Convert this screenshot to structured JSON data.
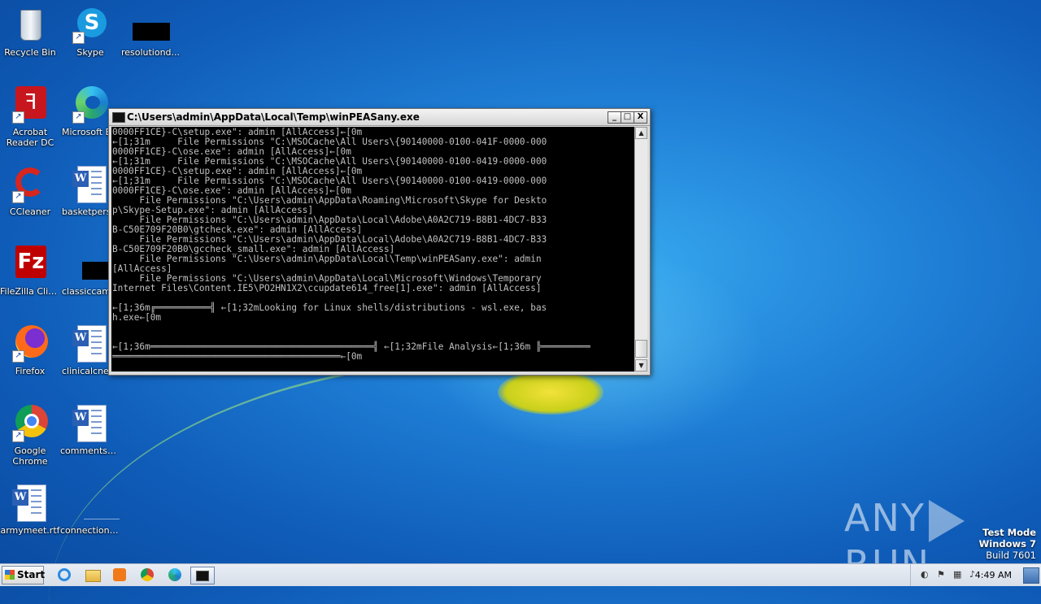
{
  "desktop": {
    "icons": [
      {
        "label": "Recycle Bin"
      },
      {
        "label": "Skype"
      },
      {
        "label": "resolutiond..."
      },
      {
        "label": "Acrobat Reader DC"
      },
      {
        "label": "Microsoft Ed"
      },
      {
        "label": "CCleaner"
      },
      {
        "label": "basketperso"
      },
      {
        "label": "FileZilla Client"
      },
      {
        "label": "classiccame"
      },
      {
        "label": "Firefox"
      },
      {
        "label": "clinicalcnet"
      },
      {
        "label": "Google Chrome"
      },
      {
        "label": "commentsst..."
      },
      {
        "label": "armymeet.rtf"
      },
      {
        "label": "connectione..."
      }
    ]
  },
  "window": {
    "title": "C:\\Users\\admin\\AppData\\Local\\Temp\\winPEASany.exe",
    "buttons": {
      "minimize": "_",
      "maximize": "□",
      "close": "X"
    },
    "console_text": "0000FF1CE}-C\\setup.exe\": admin [AllAccess]←[0m\n←[1;31m     File Permissions \"C:\\MSOCache\\All Users\\{90140000-0100-041F-0000-000\n0000FF1CE}-C\\ose.exe\": admin [AllAccess]←[0m\n←[1;31m     File Permissions \"C:\\MSOCache\\All Users\\{90140000-0100-0419-0000-000\n0000FF1CE}-C\\setup.exe\": admin [AllAccess]←[0m\n←[1;31m     File Permissions \"C:\\MSOCache\\All Users\\{90140000-0100-0419-0000-000\n0000FF1CE}-C\\ose.exe\": admin [AllAccess]←[0m\n     File Permissions \"C:\\Users\\admin\\AppData\\Roaming\\Microsoft\\Skype for Deskto\np\\Skype-Setup.exe\": admin [AllAccess]\n     File Permissions \"C:\\Users\\admin\\AppData\\Local\\Adobe\\A0A2C719-B8B1-4DC7-B33\nB-C50E709F20B0\\gtcheck.exe\": admin [AllAccess]\n     File Permissions \"C:\\Users\\admin\\AppData\\Local\\Adobe\\A0A2C719-B8B1-4DC7-B33\nB-C50E709F20B0\\gccheck_small.exe\": admin [AllAccess]\n     File Permissions \"C:\\Users\\admin\\AppData\\Local\\Temp\\winPEASany.exe\": admin\n[AllAccess]\n     File Permissions \"C:\\Users\\admin\\AppData\\Local\\Microsoft\\Windows\\Temporary\nInternet Files\\Content.IE5\\PO2HN1X2\\ccupdate614_free[1].exe\": admin [AllAccess]\n\n←[1;36m╔══════════╣ ←[1;32mLooking for Linux shells/distributions - wsl.exe, bas\nh.exe←[0m\n\n\n←[1;36m═════════════════════════════════════════╣ ←[1;32mFile Analysis←[1;36m ╠═════════\n══════════════════════════════════════════←[0m"
  },
  "watermark": {
    "brand": "ANY",
    "brand2": "RUN"
  },
  "testmode": {
    "line1": "Test Mode",
    "line2": "Windows 7",
    "line3": "Build 7601"
  },
  "taskbar": {
    "start_label": "Start",
    "clock": "4:49 AM"
  }
}
